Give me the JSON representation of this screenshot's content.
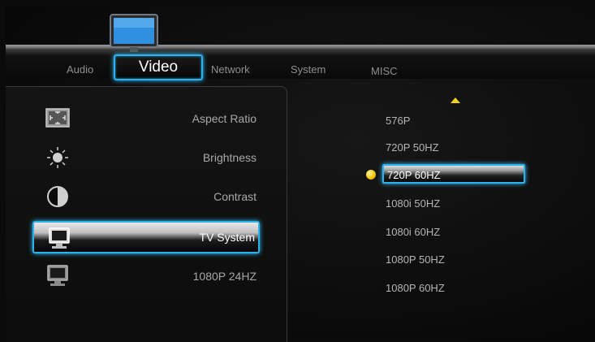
{
  "tabs": [
    {
      "label": "Audio"
    },
    {
      "label": "Video"
    },
    {
      "label": "Network"
    },
    {
      "label": "System"
    },
    {
      "label": "MISC"
    }
  ],
  "settings": [
    {
      "label": "Aspect Ratio",
      "icon": "aspect-ratio-icon"
    },
    {
      "label": "Brightness",
      "icon": "brightness-icon"
    },
    {
      "label": "Contrast",
      "icon": "contrast-icon"
    },
    {
      "label": "TV System",
      "icon": "monitor-icon"
    },
    {
      "label": "1080P 24HZ",
      "icon": "monitor-icon"
    }
  ],
  "options": [
    {
      "label": "576P"
    },
    {
      "label": "720P 50HZ"
    },
    {
      "label": "720P 60HZ"
    },
    {
      "label": "1080i 50HZ"
    },
    {
      "label": "1080i 60HZ"
    },
    {
      "label": "1080P 50HZ"
    },
    {
      "label": "1080P 60HZ"
    }
  ],
  "colors": {
    "accent": "#2bb3ee",
    "indicator": "#f2c200"
  }
}
